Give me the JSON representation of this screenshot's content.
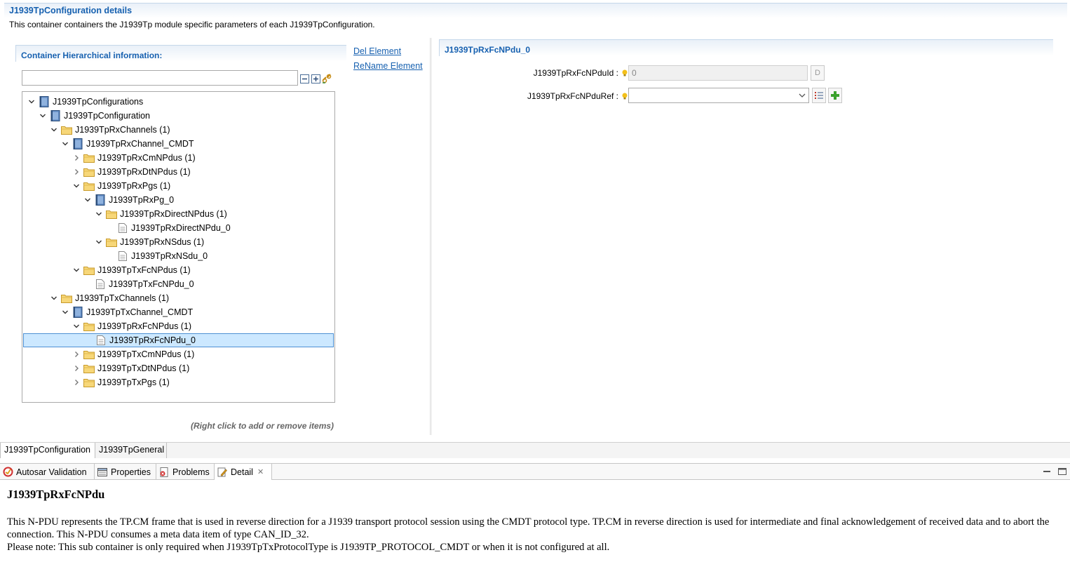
{
  "details": {
    "title": "J1939TpConfiguration details",
    "description": "This container containers the J1939Tp module specific parameters of each J1939TpConfiguration."
  },
  "left_panel": {
    "title": "Container Hierarchical information:",
    "filter_value": "",
    "hint": "(Right click to add or remove items)"
  },
  "side_links": {
    "delete": "Del Element",
    "rename": "ReName Element"
  },
  "tree": [
    {
      "label": "J1939TpConfigurations",
      "depth": 0,
      "type": "module",
      "expanded": true
    },
    {
      "label": "J1939TpConfiguration",
      "depth": 1,
      "type": "module",
      "expanded": true
    },
    {
      "label": "J1939TpRxChannels (1)",
      "depth": 2,
      "type": "folder",
      "expanded": true
    },
    {
      "label": "J1939TpRxChannel_CMDT",
      "depth": 3,
      "type": "module",
      "expanded": true
    },
    {
      "label": "J1939TpRxCmNPdus (1)",
      "depth": 4,
      "type": "folder",
      "expanded": false
    },
    {
      "label": "J1939TpRxDtNPdus (1)",
      "depth": 4,
      "type": "folder",
      "expanded": false
    },
    {
      "label": "J1939TpRxPgs (1)",
      "depth": 4,
      "type": "folder",
      "expanded": true
    },
    {
      "label": "J1939TpRxPg_0",
      "depth": 5,
      "type": "module",
      "expanded": true
    },
    {
      "label": "J1939TpRxDirectNPdus (1)",
      "depth": 6,
      "type": "folder",
      "expanded": true
    },
    {
      "label": "J1939TpRxDirectNPdu_0",
      "depth": 7,
      "type": "leaf",
      "expanded": null
    },
    {
      "label": "J1939TpRxNSdus (1)",
      "depth": 6,
      "type": "folder",
      "expanded": true
    },
    {
      "label": "J1939TpRxNSdu_0",
      "depth": 7,
      "type": "leaf",
      "expanded": null
    },
    {
      "label": "J1939TpTxFcNPdus (1)",
      "depth": 4,
      "type": "folder",
      "expanded": true
    },
    {
      "label": "J1939TpTxFcNPdu_0",
      "depth": 5,
      "type": "leaf",
      "expanded": null
    },
    {
      "label": "J1939TpTxChannels (1)",
      "depth": 2,
      "type": "folder",
      "expanded": true
    },
    {
      "label": "J1939TpTxChannel_CMDT",
      "depth": 3,
      "type": "module",
      "expanded": true
    },
    {
      "label": "J1939TpRxFcNPdus (1)",
      "depth": 4,
      "type": "folder",
      "expanded": true
    },
    {
      "label": "J1939TpRxFcNPdu_0",
      "depth": 5,
      "type": "leaf",
      "expanded": null,
      "selected": true
    },
    {
      "label": "J1939TpTxCmNPdus (1)",
      "depth": 4,
      "type": "folder",
      "expanded": false
    },
    {
      "label": "J1939TpTxDtNPdus (1)",
      "depth": 4,
      "type": "folder",
      "expanded": false
    },
    {
      "label": "J1939TpTxPgs (1)",
      "depth": 4,
      "type": "folder",
      "expanded": false
    }
  ],
  "right_panel": {
    "title": "J1939TpRxFcNPdu_0",
    "fields": {
      "pdu_id_label": "J1939TpRxFcNPduId :",
      "pdu_id_value": "0",
      "pdu_id_button": "D",
      "pdu_ref_label": "J1939TpRxFcNPduRef :",
      "pdu_ref_value": ""
    }
  },
  "editor_tabs": [
    "J1939TpConfiguration",
    "J1939TpGeneral"
  ],
  "view_tabs": [
    "Autosar Validation",
    "Properties",
    "Problems",
    "Detail"
  ],
  "detail": {
    "heading": "J1939TpRxFcNPdu",
    "paragraph1": "This N-PDU represents the TP.CM frame that is used in reverse direction for a J1939 transport protocol session using the CMDT protocol type. TP.CM in reverse direction is used for intermediate and final acknowledgement of received data and to abort the connection. This N-PDU consumes a meta data item of type CAN_ID_32.",
    "paragraph2": "Please note: This sub container is only required when J1939TpTxProtocolType is J1939TP_PROTOCOL_CMDT or when it is not configured at all."
  },
  "colors": {
    "accent": "#1761b0",
    "selection_bg": "#cce8ff",
    "selection_border": "#4d90d3",
    "folder": "#f2c94c"
  }
}
